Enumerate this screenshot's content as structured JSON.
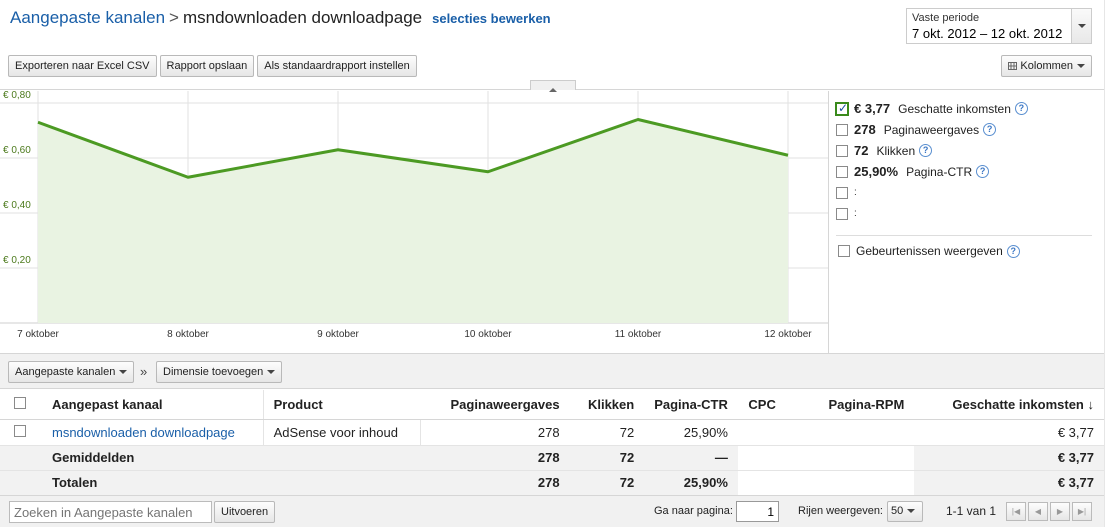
{
  "header": {
    "breadcrumb_root": "Aangepaste kanalen",
    "breadcrumb_sep": ">",
    "breadcrumb_current": "msndownloaden downloadpage",
    "edit_link": "selecties bewerken"
  },
  "period": {
    "label": "Vaste periode",
    "value": "7 okt. 2012 – 12 okt. 2012"
  },
  "toolbar": {
    "export": "Exporteren naar Excel CSV",
    "save": "Rapport opslaan",
    "default": "Als standaardrapport instellen",
    "columns": "Kolommen"
  },
  "icons": {
    "columns": "columns-grid-icon",
    "collapse": "collapse-up-icon",
    "help": "help-circle-icon",
    "sort": "sort-down-arrow-icon"
  },
  "colors": {
    "line": "#4c9a23",
    "fill": "#e9f3e2",
    "link": "#1a5fa8"
  },
  "chart_data": {
    "type": "area",
    "x": [
      "7 oktober",
      "8 oktober",
      "9 oktober",
      "10 oktober",
      "11 oktober",
      "12 oktober"
    ],
    "series": [
      {
        "name": "Geschatte inkomsten",
        "values": [
          0.73,
          0.53,
          0.63,
          0.55,
          0.74,
          0.61
        ]
      }
    ],
    "y_ticks": [
      "€ 0,80",
      "€ 0,60",
      "€ 0,40",
      "€ 0,20"
    ],
    "ylim": [
      0,
      0.8
    ],
    "grid": true
  },
  "legend": {
    "items": [
      {
        "value": "€ 3,77",
        "label": "Geschatte inkomsten",
        "checked": true
      },
      {
        "value": "278",
        "label": "Paginaweergaves",
        "checked": false
      },
      {
        "value": "72",
        "label": "Klikken",
        "checked": false
      },
      {
        "value": "25,90%",
        "label": "Pagina-CTR",
        "checked": false
      }
    ],
    "empty_mark": ":",
    "events_label": "Gebeurtenissen weergeven",
    "help_glyph": "?"
  },
  "dimensions": {
    "primary": "Aangepaste kanalen",
    "arrow": "»",
    "add": "Dimensie toevoegen"
  },
  "table": {
    "headers": [
      "Aangepast kanaal",
      "Product",
      "Paginaweergaves",
      "Klikken",
      "Pagina-CTR",
      "CPC",
      "Pagina-RPM",
      "Geschatte inkomsten"
    ],
    "sort_glyph": "↓",
    "row": {
      "channel": "msndownloaden downloadpage",
      "product": "AdSense voor inhoud",
      "pageviews": "278",
      "clicks": "72",
      "ctr": "25,90%",
      "earnings": "€ 3,77"
    },
    "avg": {
      "label": "Gemiddelden",
      "pageviews": "278",
      "clicks": "72",
      "ctr": "—",
      "earnings": "€ 3,77"
    },
    "total": {
      "label": "Totalen",
      "pageviews": "278",
      "clicks": "72",
      "ctr": "25,90%",
      "earnings": "€ 3,77"
    }
  },
  "footer": {
    "search_placeholder": "Zoeken in Aangepaste kanalen",
    "run": "Uitvoeren",
    "goto_label": "Ga naar pagina:",
    "page": "1",
    "rows_label": "Rijen weergeven:",
    "rows_value": "50",
    "range": "1-1 van 1"
  }
}
